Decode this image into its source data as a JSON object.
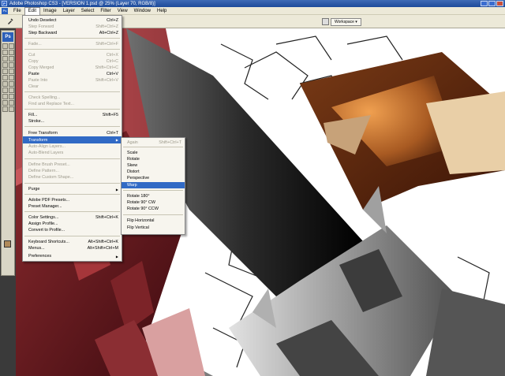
{
  "window": {
    "title": "Adobe Photoshop CS3 - [VERSION 1.psd @ 25% (Layer 70, RGB/8)]"
  },
  "menubar": [
    "File",
    "Edit",
    "Image",
    "Layer",
    "Select",
    "Filter",
    "View",
    "Window",
    "Help"
  ],
  "options_bar": {
    "workspace_label": "Workspace ▾"
  },
  "toolbox": {
    "logo": "Ps"
  },
  "edit_menu": [
    {
      "label": "Undo Deselect",
      "shortcut": "Ctrl+Z",
      "state": "enabled"
    },
    {
      "label": "Step Forward",
      "shortcut": "Shift+Ctrl+Z",
      "state": "disabled"
    },
    {
      "label": "Step Backward",
      "shortcut": "Alt+Ctrl+Z",
      "state": "enabled"
    },
    {
      "label": "Fade...",
      "shortcut": "Shift+Ctrl+F",
      "state": "disabled"
    },
    {
      "label": "Cut",
      "shortcut": "Ctrl+X",
      "state": "disabled"
    },
    {
      "label": "Copy",
      "shortcut": "Ctrl+C",
      "state": "disabled"
    },
    {
      "label": "Copy Merged",
      "shortcut": "Shift+Ctrl+C",
      "state": "disabled"
    },
    {
      "label": "Paste",
      "shortcut": "Ctrl+V",
      "state": "enabled"
    },
    {
      "label": "Paste Into",
      "shortcut": "Shift+Ctrl+V",
      "state": "disabled"
    },
    {
      "label": "Clear",
      "shortcut": "",
      "state": "disabled"
    },
    {
      "label": "Check Spelling...",
      "shortcut": "",
      "state": "disabled"
    },
    {
      "label": "Find and Replace Text...",
      "shortcut": "",
      "state": "disabled"
    },
    {
      "label": "Fill...",
      "shortcut": "Shift+F5",
      "state": "enabled"
    },
    {
      "label": "Stroke...",
      "shortcut": "",
      "state": "enabled"
    },
    {
      "label": "Free Transform",
      "shortcut": "Ctrl+T",
      "state": "enabled"
    },
    {
      "label": "Transform",
      "shortcut": "",
      "state": "highlighted",
      "submenu": true
    },
    {
      "label": "Auto-Align Layers...",
      "shortcut": "",
      "state": "disabled"
    },
    {
      "label": "Auto-Blend Layers",
      "shortcut": "",
      "state": "disabled"
    },
    {
      "label": "Define Brush Preset...",
      "shortcut": "",
      "state": "disabled"
    },
    {
      "label": "Define Pattern...",
      "shortcut": "",
      "state": "disabled"
    },
    {
      "label": "Define Custom Shape...",
      "shortcut": "",
      "state": "disabled"
    },
    {
      "label": "Purge",
      "shortcut": "",
      "state": "enabled",
      "submenu": true
    },
    {
      "label": "Adobe PDF Presets...",
      "shortcut": "",
      "state": "enabled"
    },
    {
      "label": "Preset Manager...",
      "shortcut": "",
      "state": "enabled"
    },
    {
      "label": "Color Settings...",
      "shortcut": "Shift+Ctrl+K",
      "state": "enabled"
    },
    {
      "label": "Assign Profile...",
      "shortcut": "",
      "state": "enabled"
    },
    {
      "label": "Convert to Profile...",
      "shortcut": "",
      "state": "enabled"
    },
    {
      "label": "Keyboard Shortcuts...",
      "shortcut": "Alt+Shift+Ctrl+K",
      "state": "enabled"
    },
    {
      "label": "Menus...",
      "shortcut": "Alt+Shift+Ctrl+M",
      "state": "enabled"
    },
    {
      "label": "Preferences",
      "shortcut": "",
      "state": "enabled",
      "submenu": true
    }
  ],
  "transform_menu": [
    {
      "label": "Again",
      "shortcut": "Shift+Ctrl+T",
      "state": "disabled"
    },
    {
      "label": "Scale",
      "shortcut": "",
      "state": "enabled"
    },
    {
      "label": "Rotate",
      "shortcut": "",
      "state": "enabled"
    },
    {
      "label": "Skew",
      "shortcut": "",
      "state": "enabled"
    },
    {
      "label": "Distort",
      "shortcut": "",
      "state": "enabled"
    },
    {
      "label": "Perspective",
      "shortcut": "",
      "state": "enabled"
    },
    {
      "label": "Warp",
      "shortcut": "",
      "state": "highlighted"
    },
    {
      "label": "Rotate 180°",
      "shortcut": "",
      "state": "enabled"
    },
    {
      "label": "Rotate 90° CW",
      "shortcut": "",
      "state": "enabled"
    },
    {
      "label": "Rotate 90° CCW",
      "shortcut": "",
      "state": "enabled"
    },
    {
      "label": "Flip Horizontal",
      "shortcut": "",
      "state": "enabled"
    },
    {
      "label": "Flip Vertical",
      "shortcut": "",
      "state": "enabled"
    }
  ],
  "colors": {
    "highlight": "#316ac5",
    "foreground_swatch": "#b08a5a",
    "background_swatch": "#ffffff"
  }
}
